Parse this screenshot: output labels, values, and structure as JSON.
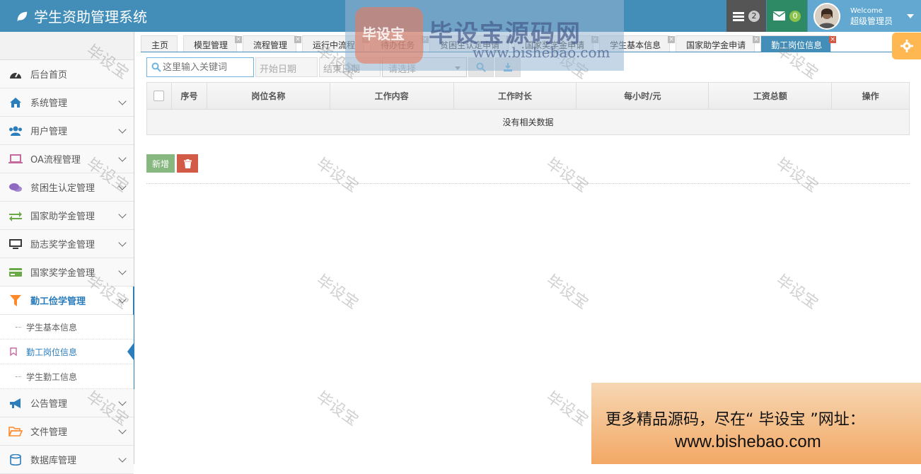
{
  "app": {
    "title": "学生资助管理系统"
  },
  "header": {
    "tasks_count": "2",
    "mail_count": "0",
    "welcome": "Welcome",
    "user_name": "超级管理员"
  },
  "sidebar": {
    "items": [
      {
        "label": "后台首页",
        "icon": "dashboard-icon",
        "color": "#393939",
        "chev": false
      },
      {
        "label": "系统管理",
        "icon": "home-icon",
        "color": "#2b7dbc",
        "chev": true
      },
      {
        "label": "用户管理",
        "icon": "users-icon",
        "color": "#2b7dbc",
        "chev": true
      },
      {
        "label": "OA流程管理",
        "icon": "laptop-icon",
        "color": "#c6699f",
        "chev": true
      },
      {
        "label": "贫困生认定管理",
        "icon": "comments-icon",
        "color": "#8e6ac3",
        "chev": true
      },
      {
        "label": "国家助学金管理",
        "icon": "exchange-icon",
        "color": "#69aa46",
        "chev": true
      },
      {
        "label": "励志奖学金管理",
        "icon": "desktop-icon",
        "color": "#393939",
        "chev": true
      },
      {
        "label": "国家奖学金管理",
        "icon": "credit-card-icon",
        "color": "#69aa46",
        "chev": true
      },
      {
        "label": "勤工俭学管理",
        "icon": "filter-icon",
        "color": "#ff892a",
        "chev": true
      }
    ],
    "sub_items": [
      {
        "label": "学生基本信息",
        "active": false
      },
      {
        "label": "勤工岗位信息",
        "active": true
      },
      {
        "label": "学生勤工信息",
        "active": false
      }
    ],
    "more_items": [
      {
        "label": "公告管理",
        "icon": "bullhorn-icon",
        "color": "#2b7dbc"
      },
      {
        "label": "文件管理",
        "icon": "folder-open-icon",
        "color": "#ff892a"
      },
      {
        "label": "数据库管理",
        "icon": "database-icon",
        "color": "#2b7dbc"
      }
    ]
  },
  "tabs": [
    {
      "label": "主页",
      "closable": false,
      "active": false
    },
    {
      "label": "模型管理",
      "closable": true,
      "active": false
    },
    {
      "label": "流程管理",
      "closable": true,
      "active": false
    },
    {
      "label": "运行中流程",
      "closable": true,
      "active": false
    },
    {
      "label": "待办任务",
      "closable": true,
      "active": false
    },
    {
      "label": "贫困生认定申请",
      "closable": true,
      "active": false
    },
    {
      "label": "国家奖学金申请",
      "closable": true,
      "active": false
    },
    {
      "label": "学生基本信息",
      "closable": true,
      "active": false
    },
    {
      "label": "国家助学金申请",
      "closable": true,
      "active": false
    },
    {
      "label": "勤工岗位信息",
      "closable": true,
      "active": true
    }
  ],
  "toolbar": {
    "search_placeholder": "这里输入关键词",
    "start_date": "开始日期",
    "end_date": "结束日期",
    "select_placeholder": "请选择"
  },
  "grid": {
    "columns": [
      "序号",
      "岗位名称",
      "工作内容",
      "工作时长",
      "每小时/元",
      "工资总额",
      "操作"
    ],
    "empty_text": "没有相关数据"
  },
  "actions": {
    "add_label": "新增"
  },
  "watermarks": {
    "text": "毕设宝",
    "logo_seal": "毕设宝",
    "logo_name": "毕设宝源码网",
    "logo_url": "www.bishebao.com"
  },
  "promo": {
    "line1": "更多精品源码，尽在“ 毕设宝 ”网址：",
    "line2": "www.bishebao.com"
  }
}
